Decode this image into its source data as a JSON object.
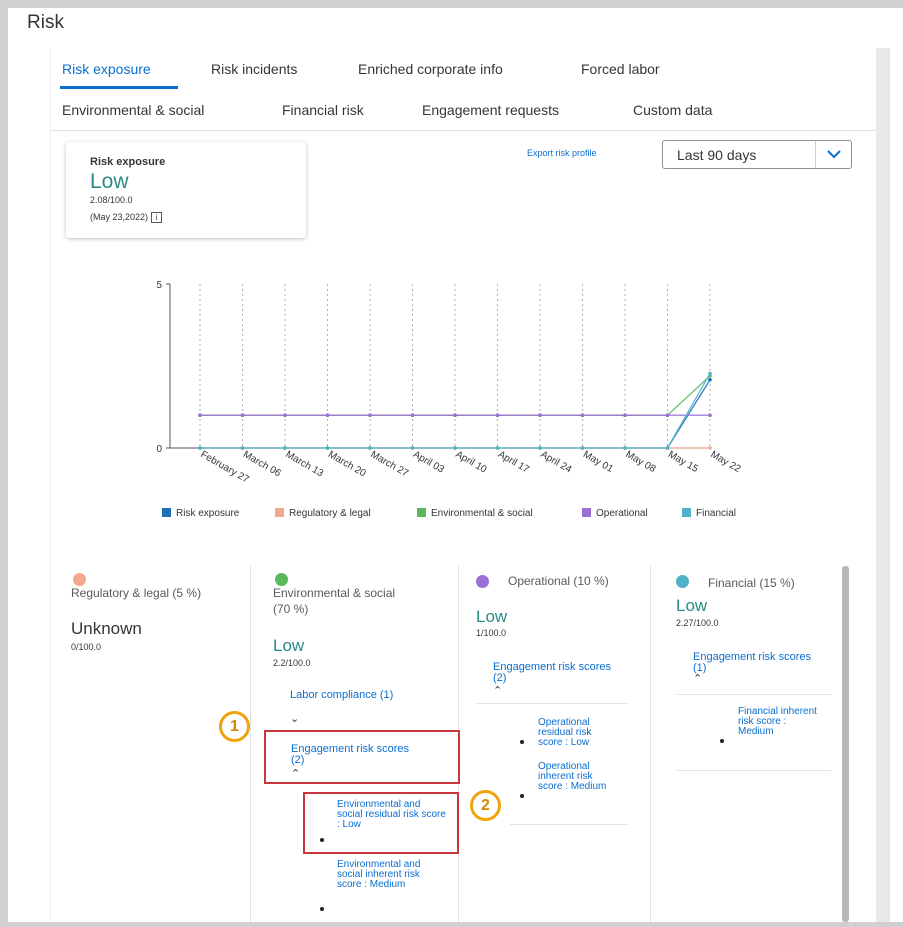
{
  "page": {
    "title": "Risk"
  },
  "tabs": [
    {
      "label": "Risk exposure",
      "active": true
    },
    {
      "label": "Risk incidents"
    },
    {
      "label": "Enriched corporate info"
    },
    {
      "label": "Forced labor"
    },
    {
      "label": "Environmental & social"
    },
    {
      "label": "Financial risk"
    },
    {
      "label": "Engagement requests"
    },
    {
      "label": "Custom data"
    }
  ],
  "summary": {
    "title": "Risk exposure",
    "value": "Low",
    "score": "2.08/100.0",
    "date": "(May 23,2022)",
    "info_icon": "info-icon"
  },
  "export_link": "Export risk profile",
  "period_select": {
    "value": "Last 90 days",
    "icon": "chevron-down-icon"
  },
  "colors": {
    "accent": "#0a6ed1",
    "low": "#2a8c84",
    "risk_exposure": "#1f6fb5",
    "regulatory": "#f0a98f",
    "environmental": "#5cb85c",
    "operational": "#9b6fd3",
    "financial": "#4fb3c8",
    "highlight_box": "#c8363c",
    "badge": "#f0a30a"
  },
  "chart_data": {
    "type": "line",
    "ylim": [
      0,
      5
    ],
    "y_ticks": [
      "0",
      "5"
    ],
    "categories": [
      "February 27",
      "March 06",
      "March 13",
      "March 20",
      "March 27",
      "April 03",
      "April 10",
      "April 17",
      "April 24",
      "May 01",
      "May 08",
      "May 15",
      "May 22"
    ],
    "grid": "vertical dotted",
    "legend_position": "bottom",
    "series": [
      {
        "name": "Risk exposure",
        "color": "#1f6fb5",
        "values": [
          0,
          0,
          0,
          0,
          0,
          0,
          0,
          0,
          0,
          0,
          0,
          0,
          2.08
        ]
      },
      {
        "name": "Regulatory & legal",
        "color": "#f0a98f",
        "values": [
          0,
          0,
          0,
          0,
          0,
          0,
          0,
          0,
          0,
          0,
          0,
          0,
          0
        ]
      },
      {
        "name": "Environmental & social",
        "color": "#5cb85c",
        "values": [
          1,
          1,
          1,
          1,
          1,
          1,
          1,
          1,
          1,
          1,
          1,
          1,
          2.2
        ]
      },
      {
        "name": "Operational",
        "color": "#9b6fd3",
        "values": [
          1,
          1,
          1,
          1,
          1,
          1,
          1,
          1,
          1,
          1,
          1,
          1,
          1
        ]
      },
      {
        "name": "Financial",
        "color": "#4fb3c8",
        "values": [
          0,
          0,
          0,
          0,
          0,
          0,
          0,
          0,
          0,
          0,
          0,
          0,
          2.27
        ]
      }
    ]
  },
  "categories": [
    {
      "key": "regulatory",
      "title": "Regulatory & legal (5 %)",
      "value": "Unknown",
      "score": "0/100.0"
    },
    {
      "key": "environmental",
      "title": "Environmental & social (70 %)",
      "value": "Low",
      "score": "2.2/100.0",
      "links": [
        "Labor compliance (1)",
        "Engagement risk scores (2)"
      ],
      "items": [
        "Environmental and social residual risk score : Low",
        "Environmental and social inherent risk score : Medium"
      ]
    },
    {
      "key": "operational",
      "title": "Operational (10 %)",
      "value": "Low",
      "score": "1/100.0",
      "links": [
        "Engagement risk scores (2)"
      ],
      "items": [
        "Operational residual risk score : Low",
        "Operational inherent risk score : Medium"
      ]
    },
    {
      "key": "financial",
      "title": "Financial (15 %)",
      "value": "Low",
      "score": "2.27/100.0",
      "links": [
        "Engagement risk scores (1)"
      ],
      "items": [
        "Financial inherent risk score : Medium"
      ]
    }
  ],
  "callouts": [
    "1",
    "2"
  ]
}
